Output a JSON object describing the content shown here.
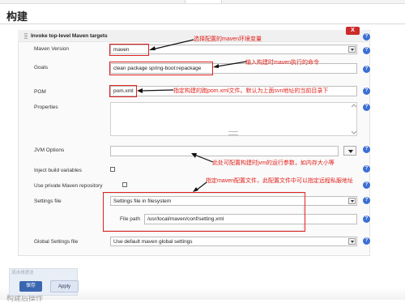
{
  "page": {
    "title": "构建"
  },
  "section": {
    "title": "Invoke top-level Maven targets",
    "delete_label": "X"
  },
  "fields": {
    "maven_version": {
      "label": "Maven Version",
      "value": "maven"
    },
    "goals": {
      "label": "Goals",
      "value": "clean package spring-boot:repackage"
    },
    "pom": {
      "label": "POM",
      "value": "pom.xml"
    },
    "properties": {
      "label": "Properties",
      "value": ""
    },
    "jvm_options": {
      "label": "JVM Options",
      "value": ""
    },
    "inject_build_variables": {
      "label": "Inject build variables",
      "checked": false
    },
    "private_repo": {
      "label": "Use private Maven repository",
      "checked": false
    },
    "settings_file": {
      "label": "Settings file",
      "value": "Settings file in filesystem",
      "file_path_label": "File path",
      "file_path_value": "/usr/local/maven/conf/setting.xml"
    },
    "global_settings": {
      "label": "Global Settings file",
      "value": "Use default maven global settings"
    }
  },
  "annotations": {
    "maven_env": "选择配置的maven环境变量",
    "goals_cmd": "输入构建时maven执行的命令",
    "pom": "指定构建的跑pom.xml文件。默认为上面svn地址的当前目录下",
    "jvm": "此处可配置构建时jvm的运行参数，如内存大小等",
    "settings": "指定maven配置文件，此配置文件中可以指定远程私服地址"
  },
  "bottom": {
    "panel_label": "流水线语法",
    "save_label": "保存",
    "apply_label": "Apply",
    "cut_text": "构建后操作"
  },
  "icons": {
    "help": "help-icon"
  },
  "colors": {
    "accent_red": "#e0201a",
    "help_blue": "#3a6fd6",
    "save_blue": "#3a66b0"
  }
}
